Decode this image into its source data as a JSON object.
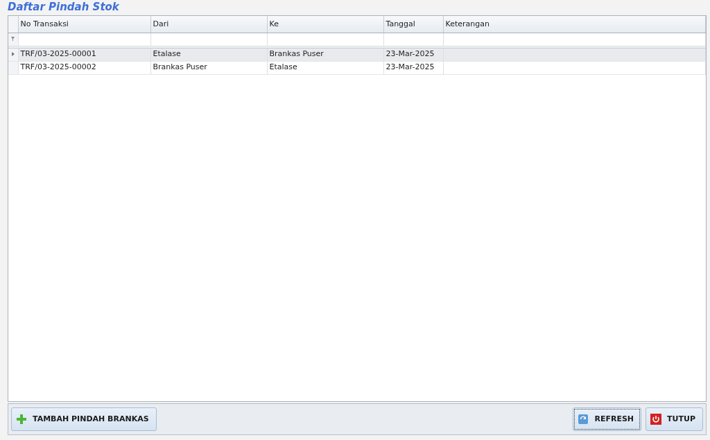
{
  "title": "Daftar Pindah Stok",
  "table": {
    "columns": [
      "No Transaksi",
      "Dari",
      "Ke",
      "Tanggal",
      "Keterangan"
    ],
    "rows": [
      {
        "cells": [
          "TRF/03-2025-00001",
          "Etalase",
          "Brankas Puser",
          "23-Mar-2025",
          ""
        ],
        "selected": true
      },
      {
        "cells": [
          "TRF/03-2025-00002",
          "Brankas Puser",
          "Etalase",
          "23-Mar-2025",
          ""
        ],
        "selected": false
      }
    ]
  },
  "buttons": [
    {
      "label": "TAMBAH PINDAH BRANKAS",
      "kind": "add",
      "focused": false
    },
    {
      "label": "REFRESH",
      "kind": "refresh",
      "focused": true
    },
    {
      "label": "TUTUP",
      "kind": "close",
      "focused": false
    }
  ]
}
